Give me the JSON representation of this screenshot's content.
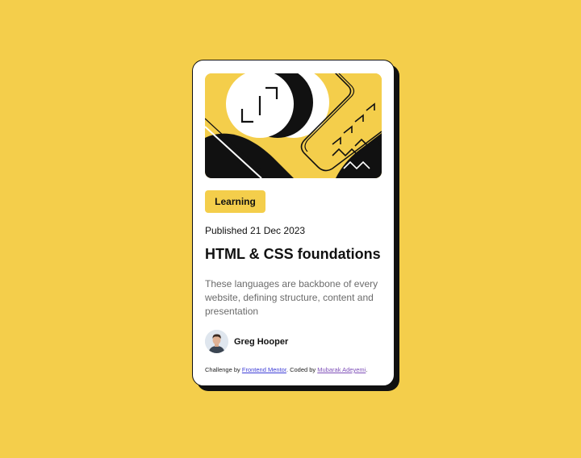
{
  "card": {
    "category": "Learning",
    "published": "Published 21 Dec 2023",
    "title": "HTML & CSS foundations",
    "description": "These languages are backbone of every website, defining structure, content and presentation",
    "author": {
      "name": "Greg Hooper"
    }
  },
  "attribution": {
    "prefix": "Challenge by ",
    "challenge_link": "Frontend Mentor",
    "middle": ". Coded by ",
    "coder_link": "Mubarak Adeyemi",
    "suffix": "."
  },
  "colors": {
    "background": "#f4ce4b",
    "card": "#ffffff",
    "ink": "#111111",
    "muted_text": "#6b6b6b",
    "link": "#3e3ed6"
  }
}
